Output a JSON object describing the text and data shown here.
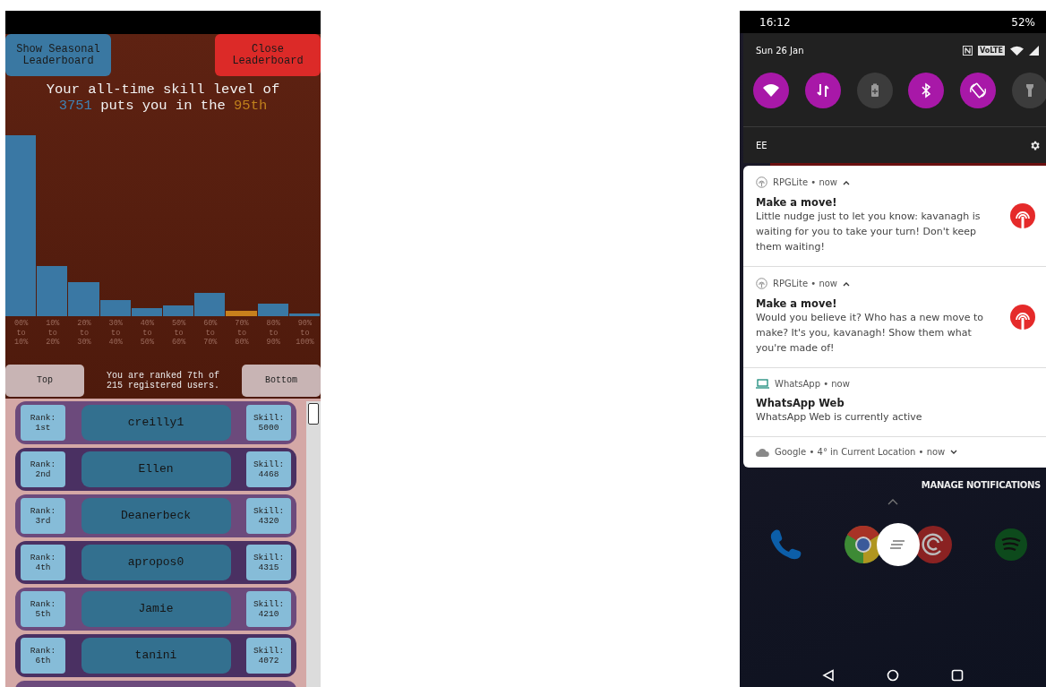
{
  "leaderboard_screen": {
    "buttons": [
      {
        "label": "Show Seasonal Leaderboard",
        "kind": "seasonal"
      },
      {
        "label": "Close Leaderboard",
        "kind": "close"
      }
    ],
    "summary": {
      "before": "Your all-time skill level of",
      "skill": "3751",
      "middle": "puts you in the",
      "percentile": "95th"
    },
    "histogram": [
      {
        "label": "00% to 10%",
        "selected": false
      },
      {
        "label": "10% to 20%",
        "selected": false
      },
      {
        "label": "20% to 30%",
        "selected": false
      },
      {
        "label": "30% to 40%",
        "selected": false
      },
      {
        "label": "40% to 50%",
        "selected": false
      },
      {
        "label": "50% to 60%",
        "selected": false
      },
      {
        "label": "60% to 70%",
        "selected": false
      },
      {
        "label": "70% to 80%",
        "selected": true
      },
      {
        "label": "80% to 90%",
        "selected": false
      },
      {
        "label": "90% to 100%",
        "selected": false
      }
    ],
    "nav": {
      "top": "Top",
      "rank_text": "You are ranked 7th of 215 registered users.",
      "bottom": "Bottom"
    },
    "rows": [
      {
        "rank_label": "Rank:",
        "rank": "1st",
        "name": "creilly1",
        "skill_label": "Skill:",
        "skill": "5000"
      },
      {
        "rank_label": "Rank:",
        "rank": "2nd",
        "name": "Ellen",
        "skill_label": "Skill:",
        "skill": "4468"
      },
      {
        "rank_label": "Rank:",
        "rank": "3rd",
        "name": "Deanerbeck",
        "skill_label": "Skill:",
        "skill": "4320"
      },
      {
        "rank_label": "Rank:",
        "rank": "4th",
        "name": "apropos0",
        "skill_label": "Skill:",
        "skill": "4315"
      },
      {
        "rank_label": "Rank:",
        "rank": "5th",
        "name": "Jamie",
        "skill_label": "Skill:",
        "skill": "4210"
      },
      {
        "rank_label": "Rank:",
        "rank": "6th",
        "name": "tanini",
        "skill_label": "Skill:",
        "skill": "4072"
      }
    ]
  },
  "notification_screen": {
    "status_bar": {
      "time": "16:12",
      "battery": "52%"
    },
    "quick_settings": {
      "date": "Sun 26 Jan",
      "volte": "VoLTE",
      "toggles": [
        {
          "kind": "wifi",
          "on": true
        },
        {
          "kind": "data",
          "on": true
        },
        {
          "kind": "battery",
          "on": false
        },
        {
          "kind": "bluetooth",
          "on": true
        },
        {
          "kind": "rotate",
          "on": true
        },
        {
          "kind": "flashlight",
          "on": false
        }
      ],
      "carrier": "EE"
    },
    "notifications": [
      {
        "kind": "rpg",
        "header": "RPGLite • now",
        "expanded": true,
        "title": "Make a move!",
        "body": "Little nudge just to let you know: kavanagh is waiting for you to take your turn! Don't keep them waiting!"
      },
      {
        "kind": "rpg",
        "header": "RPGLite • now",
        "expanded": true,
        "title": "Make a move!",
        "body": "Would you believe it? Who has a new move to make? It's you, kavanagh! Show them what you're made of!"
      },
      {
        "kind": "laptop",
        "header": "WhatsApp • now",
        "title": "WhatsApp Web",
        "body": "WhatsApp Web is currently active"
      },
      {
        "kind": "cloud",
        "header": "Google • 4° in Current Location • now",
        "expanded": false
      }
    ],
    "manage": "MANAGE NOTIFICATIONS"
  }
}
